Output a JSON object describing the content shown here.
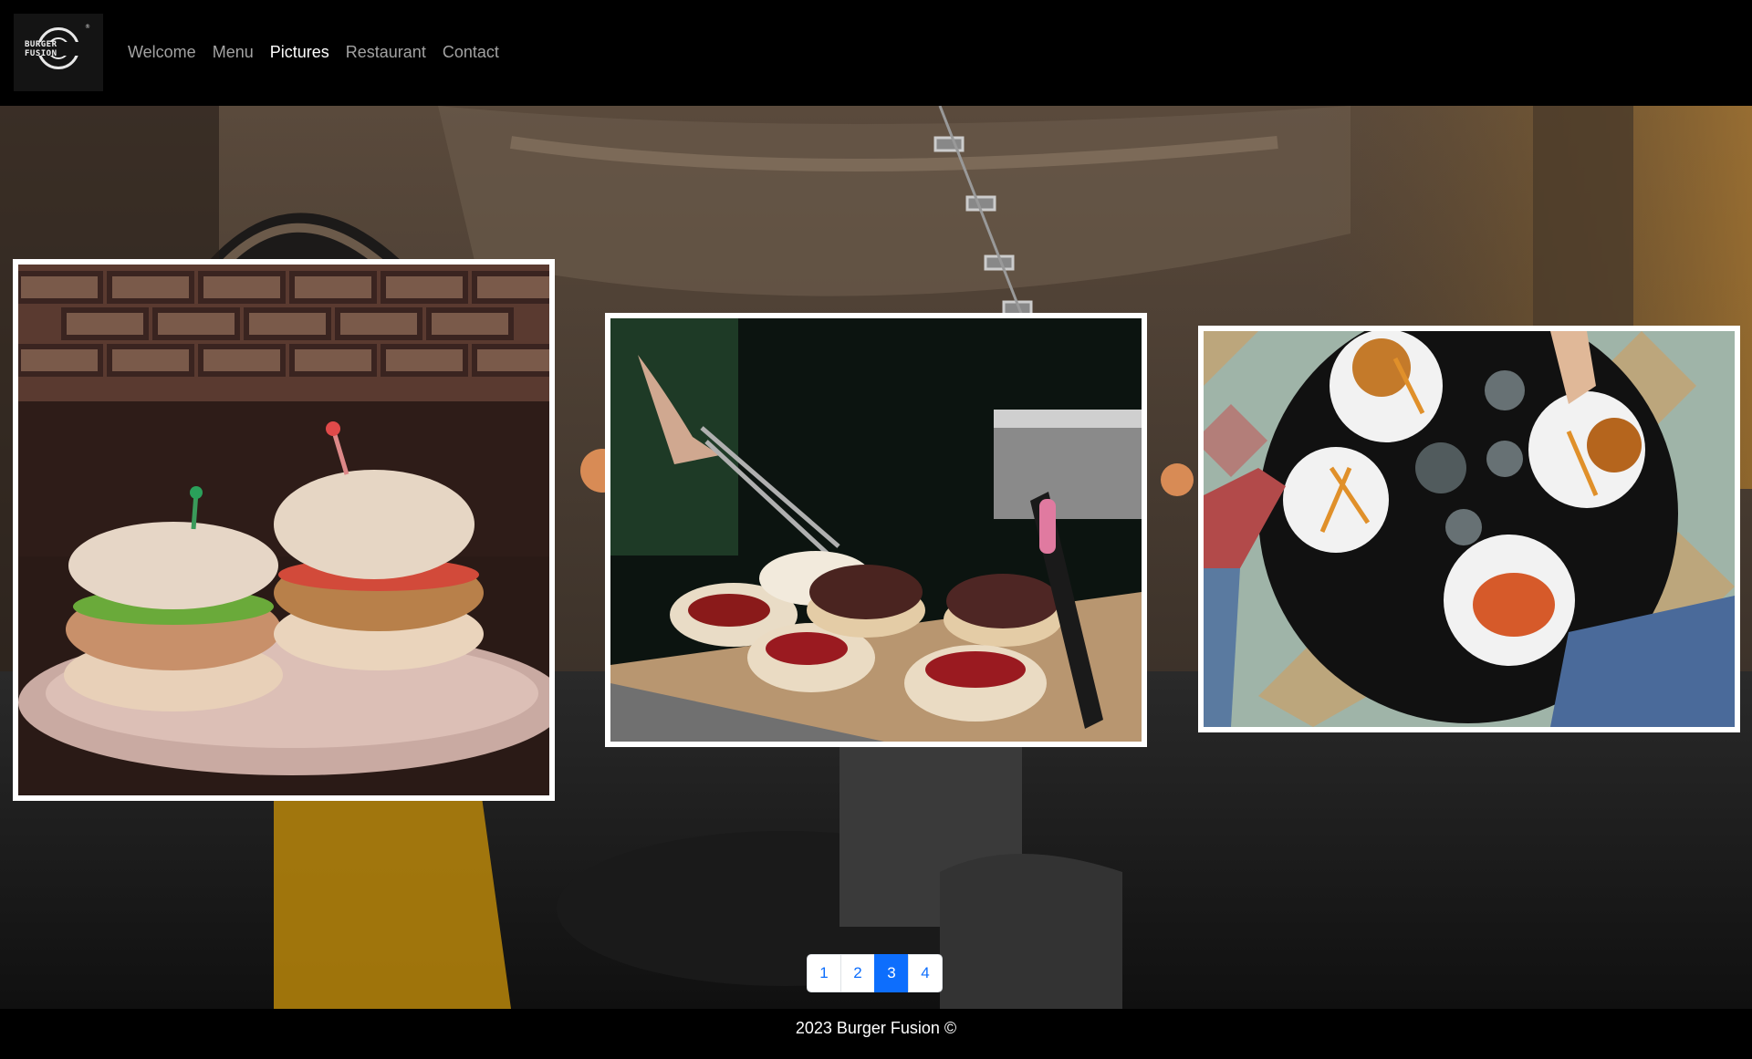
{
  "brand": {
    "logo_text": "BURGER FUSION",
    "logo_mark": "®"
  },
  "nav": {
    "items": [
      {
        "label": "Welcome",
        "active": false
      },
      {
        "label": "Menu",
        "active": false
      },
      {
        "label": "Pictures",
        "active": true
      },
      {
        "label": "Restaurant",
        "active": false
      },
      {
        "label": "Contact",
        "active": false
      }
    ]
  },
  "gallery": {
    "photos": [
      {
        "subject": "two chicken burgers on a plate"
      },
      {
        "subject": "grilling burger patties on buns"
      },
      {
        "subject": "table top view with burgers and fries"
      }
    ]
  },
  "pagination": {
    "pages": [
      "1",
      "2",
      "3",
      "4"
    ],
    "current": "3"
  },
  "footer": {
    "text": "2023 Burger Fusion ©"
  },
  "colors": {
    "accent": "#0d6efd",
    "nav_active": "#ffffff",
    "nav_inactive": "#a2a2a2",
    "background": "#000000"
  }
}
